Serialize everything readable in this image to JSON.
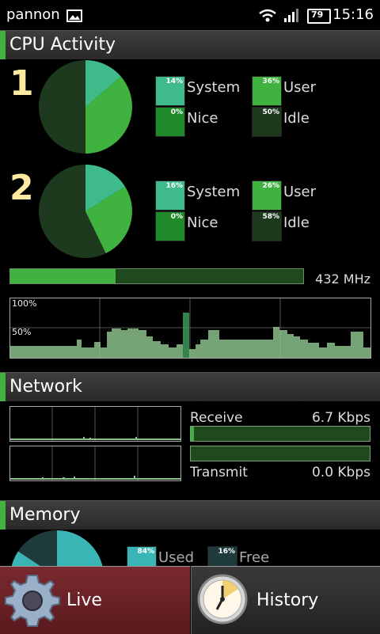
{
  "status": {
    "carrier": "pannon",
    "battery": "79",
    "time": "15:16",
    "icons": [
      "image-icon",
      "wifi-icon",
      "signal-icon",
      "battery-icon"
    ]
  },
  "cpu": {
    "title": "CPU Activity",
    "cores": [
      {
        "label": "1",
        "legend": [
          {
            "name": "System",
            "pct": "14%",
            "color": "#3fba8a"
          },
          {
            "name": "User",
            "pct": "36%",
            "color": "#3fb23f"
          },
          {
            "name": "Nice",
            "pct": "0%",
            "color": "#1f8a2a"
          },
          {
            "name": "Idle",
            "pct": "50%",
            "color": "#1e3a1e"
          }
        ]
      },
      {
        "label": "2",
        "legend": [
          {
            "name": "System",
            "pct": "16%",
            "color": "#3fba8a"
          },
          {
            "name": "User",
            "pct": "26%",
            "color": "#3fb23f"
          },
          {
            "name": "Nice",
            "pct": "0%",
            "color": "#1f8a2a"
          },
          {
            "name": "Idle",
            "pct": "58%",
            "color": "#1e3a1e"
          }
        ]
      }
    ],
    "frequency": "432 MHz",
    "frequency_fraction": 0.36,
    "graph_labels": {
      "top": "100%",
      "mid": "50%"
    }
  },
  "network": {
    "title": "Network",
    "receive_label": "Receive",
    "receive_value": "6.7 Kbps",
    "receive_fraction": 0.01,
    "transmit_label": "Transmit",
    "transmit_value": "0.0 Kbps",
    "transmit_fraction": 0.0
  },
  "memory": {
    "title": "Memory",
    "used": {
      "label": "Used",
      "pct": "84%",
      "color": "#3ab5b5"
    },
    "free": {
      "label": "Free",
      "pct": "16%",
      "color": "#1e3a3a"
    }
  },
  "tabs": {
    "live": "Live",
    "history": "History"
  }
}
